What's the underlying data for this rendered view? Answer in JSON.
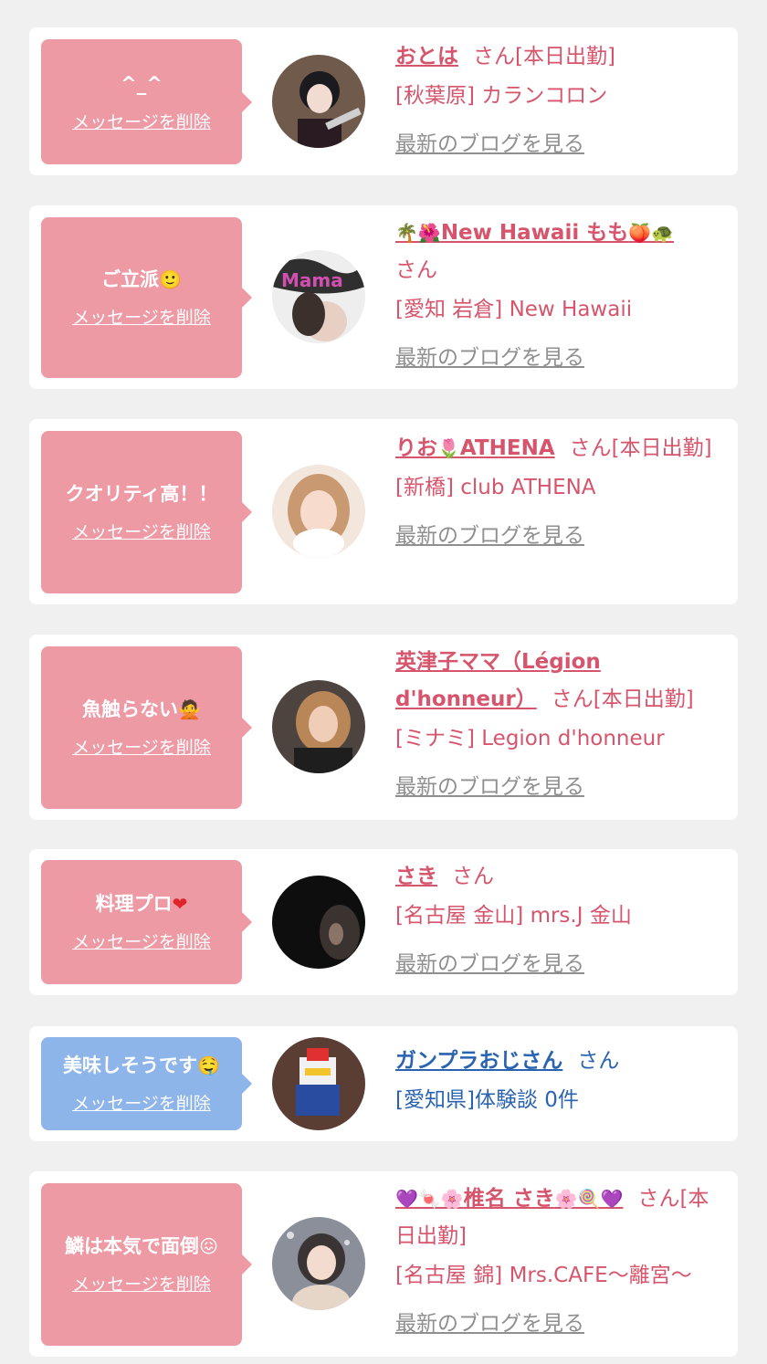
{
  "delete_label": "メッセージを削除",
  "blog_label": "最新のブログを見る",
  "san": "さん",
  "messages": [
    {
      "comment": "^_^",
      "comment_emoji": "",
      "name": "おとは",
      "name_prefix": "",
      "name_suffix": "",
      "status": "[本日出勤]",
      "shop": "[秋葉原] カランコロン",
      "blog": true,
      "theme": "pink"
    },
    {
      "comment": "ご立派",
      "comment_emoji": "🙂",
      "name": "New Hawaii もも",
      "name_prefix": "🌴🌺",
      "name_suffix": "🍑🐢",
      "status": "",
      "shop": "[愛知 岩倉] New Hawaii",
      "blog": true,
      "theme": "pink"
    },
    {
      "comment": "クオリティ高！！",
      "comment_emoji": "",
      "name": "りお",
      "name_mid": "🌷",
      "name_rest": "ATHENA",
      "name_prefix": "",
      "name_suffix": "",
      "status": "[本日出勤]",
      "shop": "[新橋] club ATHENA",
      "blog": true,
      "theme": "pink"
    },
    {
      "comment": "魚触らない",
      "comment_emoji": "🙅",
      "name": "英津子ママ（Légion d'honneur）",
      "name_prefix": "",
      "name_suffix": "",
      "status": "[本日出勤]",
      "shop": "[ミナミ] Legion d'honneur",
      "blog": true,
      "theme": "pink"
    },
    {
      "comment": "料理プロ",
      "comment_emoji": "❤",
      "name": "さき",
      "name_prefix": "",
      "name_suffix": "",
      "status": "",
      "shop": "[名古屋 金山] mrs.J 金山",
      "blog": true,
      "theme": "pink"
    },
    {
      "comment": "美味しそうです",
      "comment_emoji": "🤤",
      "name": "ガンプラおじさん",
      "name_prefix": "",
      "name_suffix": "",
      "status": "",
      "shop": "[愛知県]体験談 0件",
      "blog": false,
      "theme": "blue"
    },
    {
      "comment": "鱗は本気で面倒",
      "comment_emoji": "😖",
      "name": "椎名 さき",
      "name_prefix": "💜🍬🌸",
      "name_suffix": "🌸🍭💜",
      "status": "[本日出勤]",
      "shop": "[名古屋 錦] Mrs.CAFE〜離宮〜",
      "blog": true,
      "theme": "pink"
    }
  ],
  "colors": {
    "pink_bubble": "#ed9aa5",
    "blue_bubble": "#8db5ea",
    "name_pink": "#d6556c",
    "name_blue": "#2a63b0",
    "link_gray": "#8f8f8f"
  }
}
